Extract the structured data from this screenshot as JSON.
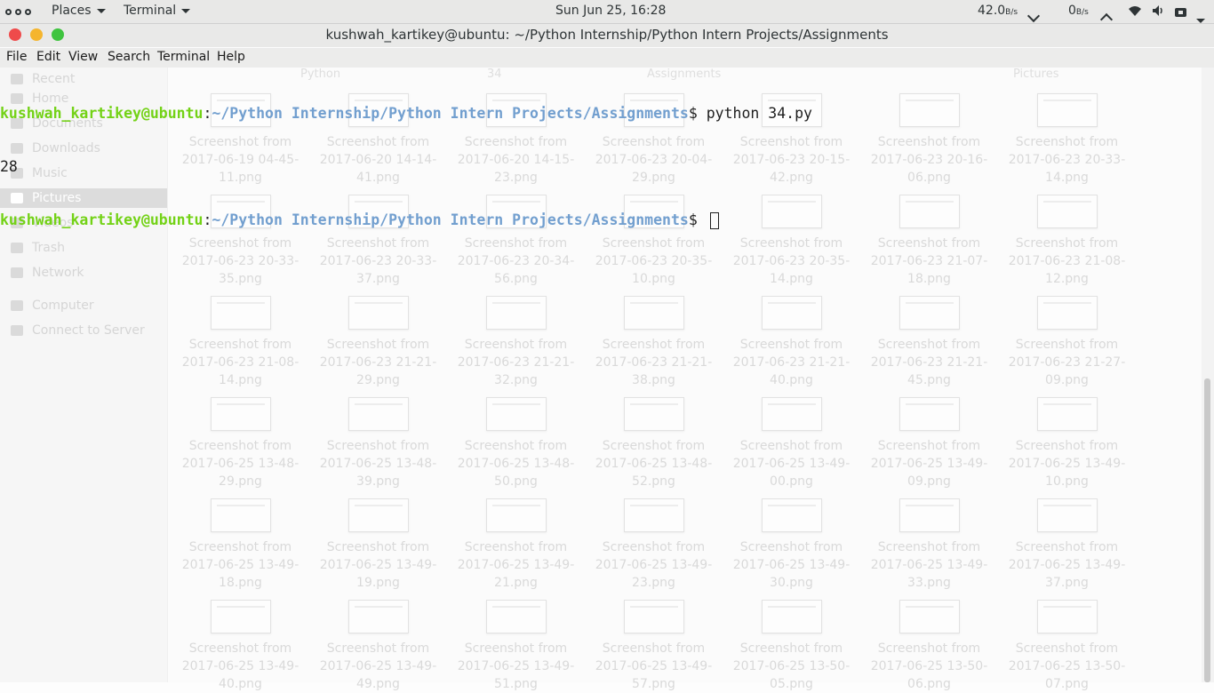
{
  "topbar": {
    "places": "Places",
    "app": "Terminal",
    "clock": "Sun Jun 25, 16:28",
    "net_down_value": "42.0",
    "net_down_unit": "B/s",
    "net_up_value": "0",
    "net_up_unit": "B/s"
  },
  "window": {
    "title": "kushwah_kartikey@ubuntu: ~/Python Internship/Python Intern Projects/Assignments"
  },
  "menu": [
    "File",
    "Edit",
    "View",
    "Search",
    "Terminal",
    "Help"
  ],
  "terminal": {
    "prompt_user": "kushwah_kartikey@ubuntu",
    "prompt_sep": ":",
    "prompt_path": "~/Python Internship/Python Intern Projects/Assignments",
    "prompt_end": "$ ",
    "command": "python 34.py",
    "output": "28"
  },
  "background": {
    "sidebar": [
      "Recent",
      "Home",
      "Documents",
      "Downloads",
      "Music",
      "Pictures",
      "Videos",
      "Trash",
      "Network",
      "Computer",
      "Connect to Server"
    ],
    "tabs": [
      "Python",
      "34",
      "Assignments",
      "Pictures"
    ],
    "files": [
      [
        "Screenshot from",
        "2017-06-19 04-45-",
        "11.png"
      ],
      [
        "Screenshot from",
        "2017-06-20 14-14-",
        "41.png"
      ],
      [
        "Screenshot from",
        "2017-06-20 14-15-",
        "23.png"
      ],
      [
        "Screenshot from",
        "2017-06-23 20-04-",
        "29.png"
      ],
      [
        "Screenshot from",
        "2017-06-23 20-15-",
        "42.png"
      ],
      [
        "Screenshot from",
        "2017-06-23 20-16-",
        "06.png"
      ],
      [
        "Screenshot from",
        "2017-06-23 20-33-",
        "14.png"
      ],
      [
        "Screenshot from",
        "2017-06-23 20-33-",
        "35.png"
      ],
      [
        "Screenshot from",
        "2017-06-23 20-33-",
        "37.png"
      ],
      [
        "Screenshot from",
        "2017-06-23 20-34-",
        "56.png"
      ],
      [
        "Screenshot from",
        "2017-06-23 20-35-",
        "10.png"
      ],
      [
        "Screenshot from",
        "2017-06-23 20-35-",
        "14.png"
      ],
      [
        "Screenshot from",
        "2017-06-23 21-07-",
        "18.png"
      ],
      [
        "Screenshot from",
        "2017-06-23 21-08-",
        "12.png"
      ],
      [
        "Screenshot from",
        "2017-06-23 21-08-",
        "14.png"
      ],
      [
        "Screenshot from",
        "2017-06-23 21-21-",
        "29.png"
      ],
      [
        "Screenshot from",
        "2017-06-23 21-21-",
        "32.png"
      ],
      [
        "Screenshot from",
        "2017-06-23 21-21-",
        "38.png"
      ],
      [
        "Screenshot from",
        "2017-06-23 21-21-",
        "40.png"
      ],
      [
        "Screenshot from",
        "2017-06-23 21-21-",
        "45.png"
      ],
      [
        "Screenshot from",
        "2017-06-23 21-27-",
        "09.png"
      ],
      [
        "Screenshot from",
        "2017-06-25 13-48-",
        "29.png"
      ],
      [
        "Screenshot from",
        "2017-06-25 13-48-",
        "39.png"
      ],
      [
        "Screenshot from",
        "2017-06-25 13-48-",
        "50.png"
      ],
      [
        "Screenshot from",
        "2017-06-25 13-48-",
        "52.png"
      ],
      [
        "Screenshot from",
        "2017-06-25 13-49-",
        "00.png"
      ],
      [
        "Screenshot from",
        "2017-06-25 13-49-",
        "09.png"
      ],
      [
        "Screenshot from",
        "2017-06-25 13-49-",
        "10.png"
      ],
      [
        "Screenshot from",
        "2017-06-25 13-49-",
        "18.png"
      ],
      [
        "Screenshot from",
        "2017-06-25 13-49-",
        "19.png"
      ],
      [
        "Screenshot from",
        "2017-06-25 13-49-",
        "21.png"
      ],
      [
        "Screenshot from",
        "2017-06-25 13-49-",
        "23.png"
      ],
      [
        "Screenshot from",
        "2017-06-25 13-49-",
        "30.png"
      ],
      [
        "Screenshot from",
        "2017-06-25 13-49-",
        "33.png"
      ],
      [
        "Screenshot from",
        "2017-06-25 13-49-",
        "37.png"
      ],
      [
        "Screenshot from",
        "2017-06-25 13-49-",
        "40.png"
      ],
      [
        "Screenshot from",
        "2017-06-25 13-49-",
        "49.png"
      ],
      [
        "Screenshot from",
        "2017-06-25 13-49-",
        "51.png"
      ],
      [
        "Screenshot from",
        "2017-06-25 13-49-",
        "57.png"
      ],
      [
        "Screenshot from",
        "2017-06-25 13-50-",
        "05.png"
      ],
      [
        "Screenshot from",
        "2017-06-25 13-50-",
        "06.png"
      ],
      [
        "Screenshot from",
        "2017-06-25 13-50-",
        "07.png"
      ]
    ]
  },
  "colors": {
    "prompt_user": "#73d216",
    "prompt_path": "#729fcf",
    "close": "#ef4b4b",
    "minimize": "#f5b52e",
    "maximize": "#3fc43f"
  }
}
